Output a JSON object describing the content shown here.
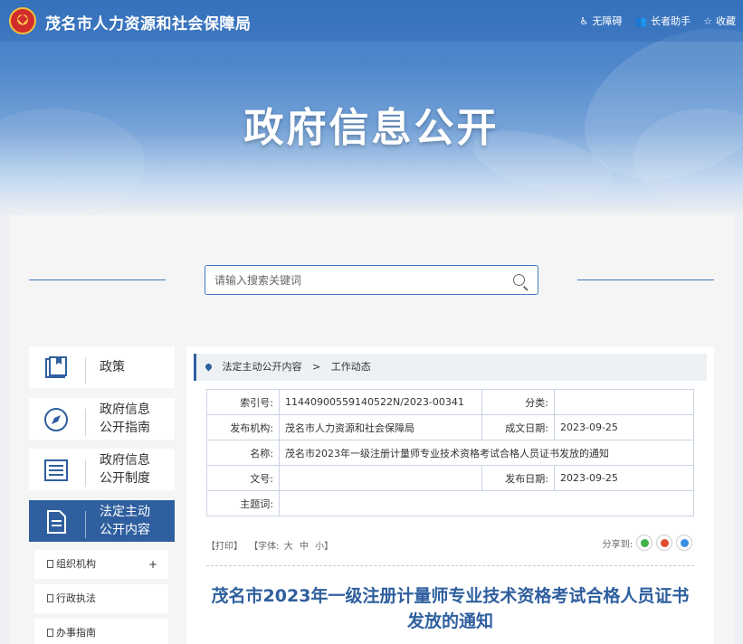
{
  "header": {
    "site_name": "茂名市人力资源和社会保障局",
    "tools": [
      "无障碍",
      "长者助手",
      "收藏"
    ],
    "banner_title": "政府信息公开"
  },
  "search": {
    "placeholder": "请输入搜索关键词"
  },
  "sidebar": {
    "items": [
      {
        "label_line1": "政策",
        "label_line2": "",
        "icon": "book-icon"
      },
      {
        "label_line1": "政府信息",
        "label_line2": "公开指南",
        "icon": "compass-icon"
      },
      {
        "label_line1": "政府信息",
        "label_line2": "公开制度",
        "icon": "list-icon"
      },
      {
        "label_line1": "法定主动",
        "label_line2": "公开内容",
        "icon": "document-icon",
        "active": true
      }
    ],
    "sub_items": [
      "组织机构",
      "行政执法",
      "办事指南"
    ]
  },
  "breadcrumb": {
    "level1": "法定主动公开内容",
    "separator": ">",
    "level2": "工作动态"
  },
  "info": {
    "index_label": "索引号:",
    "index_value": "11440900559140522N/2023-00341",
    "category_label": "分类:",
    "category_value": "",
    "publisher_label": "发布机构:",
    "publisher_value": "茂名市人力资源和社会保障局",
    "created_label": "成文日期:",
    "created_value": "2023-09-25",
    "name_label": "名称:",
    "name_value": "茂名市2023年一级注册计量师专业技术资格考试合格人员证书发放的通知",
    "docno_label": "文号:",
    "docno_value": "",
    "pubdate_label": "发布日期:",
    "pubdate_value": "2023-09-25",
    "subject_label": "主题词:",
    "subject_value": ""
  },
  "article_tools": {
    "print": "【打印】",
    "font_prefix": "【字体:",
    "font_large": "大",
    "font_medium": "中",
    "font_small": "小】",
    "share_label": "分享到:"
  },
  "article": {
    "title": "茂名市2023年一级注册计量师专业技术资格考试合格人员证书发放的通知"
  }
}
